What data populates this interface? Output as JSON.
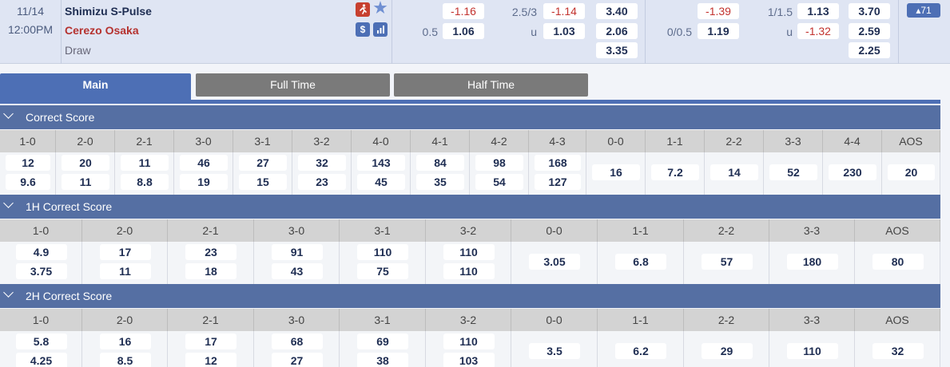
{
  "match": {
    "date": "11/14",
    "time": "12:00PM",
    "home": "Shimizu S-Pulse",
    "away": "Cerezo Osaka",
    "draw": "Draw"
  },
  "icons": {
    "live": "running-person-icon",
    "fav": "star-icon",
    "money": "dollar-icon",
    "stats": "bar-chart-icon"
  },
  "odds": {
    "ft_hdp": {
      "line_home": "",
      "line_away": "0.5",
      "home": "-1.16",
      "away": "1.06"
    },
    "ft_ou": {
      "line": "2.5/3",
      "u": "u",
      "over": "-1.14",
      "under": "1.03"
    },
    "ft_1x2": {
      "home": "3.40",
      "away": "2.06",
      "draw": "3.35"
    },
    "ht_hdp": {
      "line_away": "0/0.5",
      "home": "-1.39",
      "away": "1.19"
    },
    "ht_ou": {
      "line": "1/1.5",
      "u": "u",
      "over": "1.13",
      "under": "-1.32"
    },
    "ht_1x2": {
      "home": "3.70",
      "away": "2.59",
      "draw": "2.25"
    }
  },
  "more_bets": "▴71",
  "tabs": [
    {
      "label": "Main"
    },
    {
      "label": "Full Time"
    },
    {
      "label": "Half Time"
    }
  ],
  "colors": {
    "accent": "#4d6fb5",
    "section": "#556fa3",
    "negative": "#c2322e"
  },
  "sections": [
    {
      "title": "Correct Score",
      "headers": [
        "1-0",
        "2-0",
        "2-1",
        "3-0",
        "3-1",
        "3-2",
        "4-0",
        "4-1",
        "4-2",
        "4-3",
        "0-0",
        "1-1",
        "2-2",
        "3-3",
        "4-4",
        "AOS"
      ],
      "home": [
        "12",
        "20",
        "11",
        "46",
        "27",
        "32",
        "143",
        "84",
        "98",
        "168"
      ],
      "away": [
        "9.6",
        "11",
        "8.8",
        "19",
        "15",
        "23",
        "45",
        "35",
        "54",
        "127"
      ],
      "draws": [
        "16",
        "7.2",
        "14",
        "52",
        "230",
        "20"
      ]
    },
    {
      "title": "1H Correct Score",
      "headers": [
        "1-0",
        "2-0",
        "2-1",
        "3-0",
        "3-1",
        "3-2",
        "0-0",
        "1-1",
        "2-2",
        "3-3",
        "AOS"
      ],
      "home": [
        "4.9",
        "17",
        "23",
        "91",
        "110",
        "110"
      ],
      "away": [
        "3.75",
        "11",
        "18",
        "43",
        "75",
        "110"
      ],
      "draws": [
        "3.05",
        "6.8",
        "57",
        "180",
        "80"
      ]
    },
    {
      "title": "2H Correct Score",
      "headers": [
        "1-0",
        "2-0",
        "2-1",
        "3-0",
        "3-1",
        "3-2",
        "0-0",
        "1-1",
        "2-2",
        "3-3",
        "AOS"
      ],
      "home": [
        "5.8",
        "16",
        "17",
        "68",
        "69",
        "110"
      ],
      "away": [
        "4.25",
        "8.5",
        "12",
        "27",
        "38",
        "103"
      ],
      "draws": [
        "3.5",
        "6.2",
        "29",
        "110",
        "32"
      ]
    }
  ]
}
